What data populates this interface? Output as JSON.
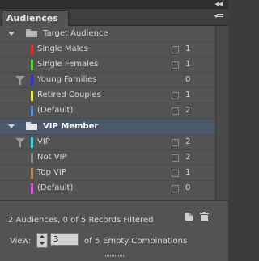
{
  "panel": {
    "tab_label": "Audiences",
    "tab_close": "×"
  },
  "groups": [
    {
      "name": "Target Audience",
      "items": [
        {
          "label": "Single Males",
          "color": "#e0302a",
          "count": "1",
          "filtered": false
        },
        {
          "label": "Single Females",
          "color": "#5ed34a",
          "count": "1",
          "filtered": false
        },
        {
          "label": "Young Families",
          "color": "#2b2fd6",
          "count": "0",
          "filtered": true
        },
        {
          "label": "Retired Couples",
          "color": "#f0e64a",
          "count": "1",
          "filtered": false
        },
        {
          "label": "(Default)",
          "color": "#5b8fd8",
          "count": "2",
          "filtered": false
        }
      ]
    },
    {
      "name": "VIP Member",
      "selected": true,
      "items": [
        {
          "label": "VIP",
          "color": "#3fd6d6",
          "count": "2",
          "filtered": true
        },
        {
          "label": "Not VIP",
          "color": "#8a8a8a",
          "count": "2",
          "filtered": false
        },
        {
          "label": "Top VIP",
          "color": "#b88a5a",
          "count": "1",
          "filtered": false
        },
        {
          "label": "(Default)",
          "color": "#d65ad6",
          "count": "0",
          "filtered": false
        }
      ]
    }
  ],
  "footer": {
    "status": "2 Audiences, 0 of 5 Records Filtered",
    "view_label": "View:",
    "view_value": "3",
    "of_text": "of 5",
    "empty_text": "Empty Combinations"
  }
}
